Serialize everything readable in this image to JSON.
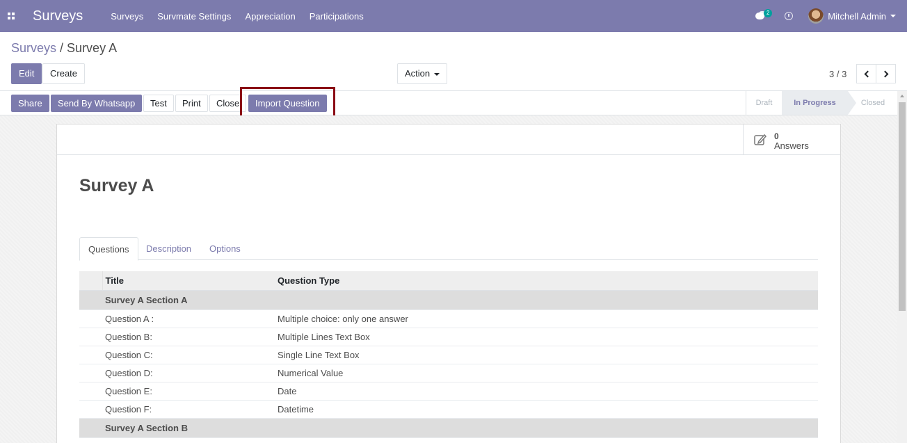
{
  "navbar": {
    "brand": "Surveys",
    "menu": [
      "Surveys",
      "Survmate Settings",
      "Appreciation",
      "Participations"
    ],
    "chat_count": "2",
    "user": "Mitchell Admin"
  },
  "breadcrumb": {
    "parent": "Surveys",
    "separator": " / ",
    "current": "Survey A"
  },
  "control": {
    "edit": "Edit",
    "create": "Create",
    "action": "Action",
    "pager": "3 / 3"
  },
  "header_buttons": {
    "share": "Share",
    "whatsapp": "Send By Whatsapp",
    "test": "Test",
    "print": "Print",
    "close": "Close",
    "import": "Import Question"
  },
  "statusbar": {
    "stages": [
      "Draft",
      "In Progress",
      "Closed"
    ],
    "active": "In Progress"
  },
  "stat_button": {
    "value": "0",
    "label": "Answers"
  },
  "survey": {
    "title": "Survey A"
  },
  "tabs": [
    "Questions",
    "Description",
    "Options"
  ],
  "table": {
    "headers": [
      "Title",
      "Question Type"
    ],
    "rows": [
      {
        "section": true,
        "title": "Survey A Section A",
        "type": ""
      },
      {
        "section": false,
        "title": "Question A :",
        "type": "Multiple choice: only one answer"
      },
      {
        "section": false,
        "title": "Question B:",
        "type": "Multiple Lines Text Box"
      },
      {
        "section": false,
        "title": "Question C:",
        "type": "Single Line Text Box"
      },
      {
        "section": false,
        "title": "Question D:",
        "type": "Numerical Value"
      },
      {
        "section": false,
        "title": "Question E:",
        "type": "Date"
      },
      {
        "section": false,
        "title": "Question F:",
        "type": "Datetime"
      },
      {
        "section": true,
        "title": "Survey A Section B",
        "type": ""
      }
    ]
  },
  "colors": {
    "brand": "#7c7bad",
    "highlight": "#8b0d16"
  }
}
